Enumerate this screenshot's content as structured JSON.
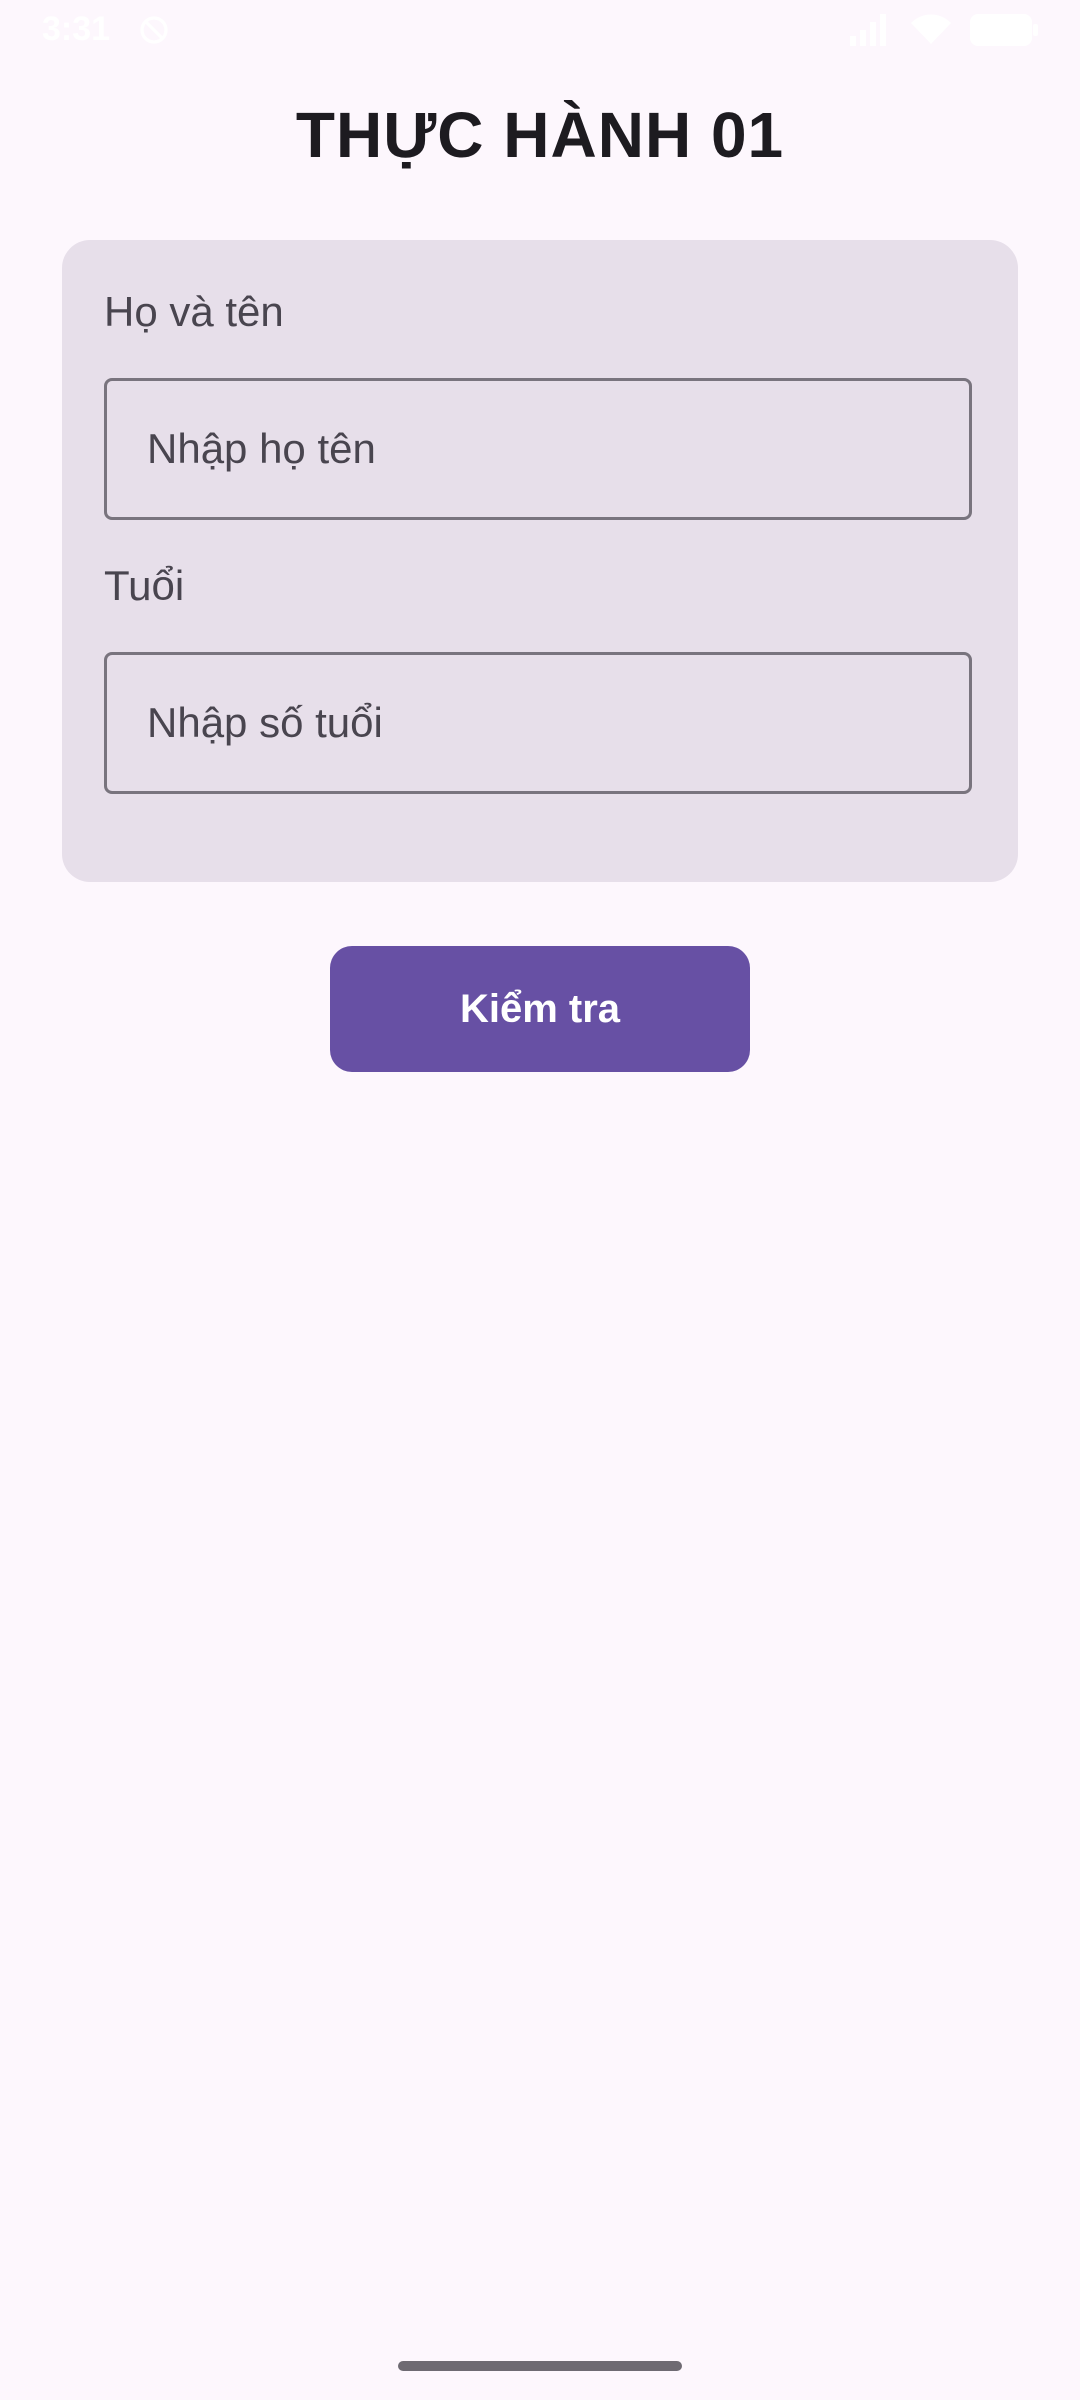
{
  "status_bar": {
    "time": "3:31",
    "icons": [
      "do-not-disturb-icon",
      "signal-icon",
      "wifi-icon",
      "battery-icon"
    ],
    "color": "#ffffff"
  },
  "page": {
    "title": "THỰC HÀNH 01"
  },
  "form": {
    "name_label": "Họ và tên",
    "name_placeholder": "Nhập họ tên",
    "name_value": "",
    "age_label": "Tuổi",
    "age_placeholder": "Nhập số tuổi",
    "age_value": ""
  },
  "actions": {
    "check_label": "Kiểm tra"
  },
  "colors": {
    "background": "#fdf7fd",
    "card": "#e7dfea",
    "primary": "#6750a4",
    "outline": "#79747e",
    "text": "#1d1b20"
  }
}
